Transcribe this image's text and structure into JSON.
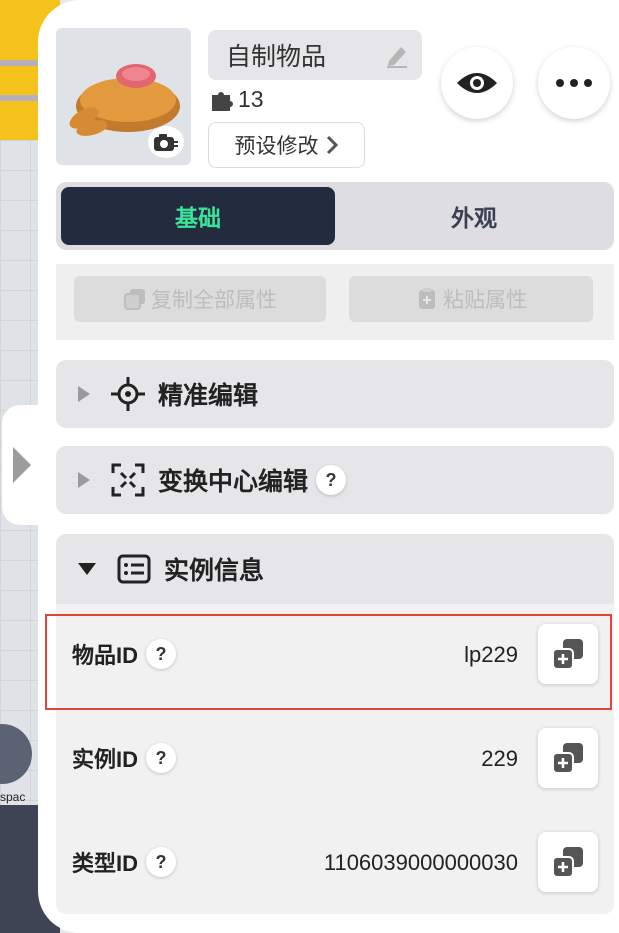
{
  "scene": {
    "label_fragment": "spac"
  },
  "header": {
    "item_name": "自制物品",
    "count": "13",
    "preset_label": "预设修改"
  },
  "tabs": [
    {
      "label": "基础",
      "active": true
    },
    {
      "label": "外观",
      "active": false
    }
  ],
  "actions": {
    "copy_all": "复制全部属性",
    "paste": "粘贴属性"
  },
  "sections": {
    "precise_edit": "精准编辑",
    "transform_center": "变换中心编辑",
    "instance_info": "实例信息"
  },
  "info_rows": [
    {
      "label": "物品ID",
      "value": "lp229"
    },
    {
      "label": "实例ID",
      "value": "229"
    },
    {
      "label": "类型ID",
      "value": "1106039000000030"
    }
  ],
  "colors": {
    "active_tab_bg": "#232b3e",
    "active_tab_text": "#3ee39b",
    "highlight": "#e0443b"
  }
}
